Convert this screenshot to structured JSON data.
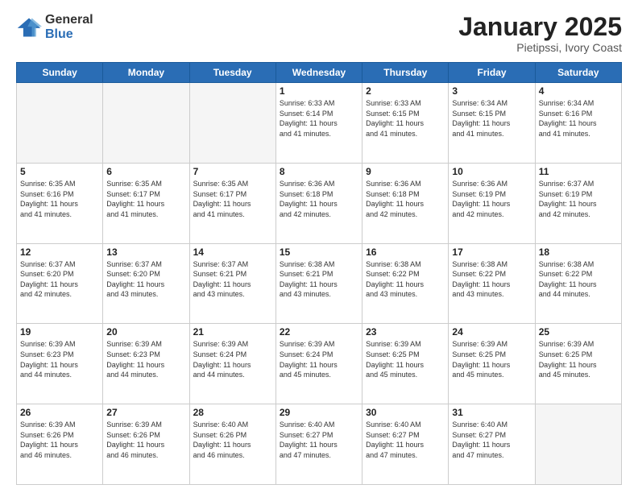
{
  "logo": {
    "general": "General",
    "blue": "Blue"
  },
  "header": {
    "month": "January 2025",
    "location": "Pietipssi, Ivory Coast"
  },
  "weekdays": [
    "Sunday",
    "Monday",
    "Tuesday",
    "Wednesday",
    "Thursday",
    "Friday",
    "Saturday"
  ],
  "weeks": [
    [
      {
        "day": "",
        "info": ""
      },
      {
        "day": "",
        "info": ""
      },
      {
        "day": "",
        "info": ""
      },
      {
        "day": "1",
        "info": "Sunrise: 6:33 AM\nSunset: 6:14 PM\nDaylight: 11 hours\nand 41 minutes."
      },
      {
        "day": "2",
        "info": "Sunrise: 6:33 AM\nSunset: 6:15 PM\nDaylight: 11 hours\nand 41 minutes."
      },
      {
        "day": "3",
        "info": "Sunrise: 6:34 AM\nSunset: 6:15 PM\nDaylight: 11 hours\nand 41 minutes."
      },
      {
        "day": "4",
        "info": "Sunrise: 6:34 AM\nSunset: 6:16 PM\nDaylight: 11 hours\nand 41 minutes."
      }
    ],
    [
      {
        "day": "5",
        "info": "Sunrise: 6:35 AM\nSunset: 6:16 PM\nDaylight: 11 hours\nand 41 minutes."
      },
      {
        "day": "6",
        "info": "Sunrise: 6:35 AM\nSunset: 6:17 PM\nDaylight: 11 hours\nand 41 minutes."
      },
      {
        "day": "7",
        "info": "Sunrise: 6:35 AM\nSunset: 6:17 PM\nDaylight: 11 hours\nand 41 minutes."
      },
      {
        "day": "8",
        "info": "Sunrise: 6:36 AM\nSunset: 6:18 PM\nDaylight: 11 hours\nand 42 minutes."
      },
      {
        "day": "9",
        "info": "Sunrise: 6:36 AM\nSunset: 6:18 PM\nDaylight: 11 hours\nand 42 minutes."
      },
      {
        "day": "10",
        "info": "Sunrise: 6:36 AM\nSunset: 6:19 PM\nDaylight: 11 hours\nand 42 minutes."
      },
      {
        "day": "11",
        "info": "Sunrise: 6:37 AM\nSunset: 6:19 PM\nDaylight: 11 hours\nand 42 minutes."
      }
    ],
    [
      {
        "day": "12",
        "info": "Sunrise: 6:37 AM\nSunset: 6:20 PM\nDaylight: 11 hours\nand 42 minutes."
      },
      {
        "day": "13",
        "info": "Sunrise: 6:37 AM\nSunset: 6:20 PM\nDaylight: 11 hours\nand 43 minutes."
      },
      {
        "day": "14",
        "info": "Sunrise: 6:37 AM\nSunset: 6:21 PM\nDaylight: 11 hours\nand 43 minutes."
      },
      {
        "day": "15",
        "info": "Sunrise: 6:38 AM\nSunset: 6:21 PM\nDaylight: 11 hours\nand 43 minutes."
      },
      {
        "day": "16",
        "info": "Sunrise: 6:38 AM\nSunset: 6:22 PM\nDaylight: 11 hours\nand 43 minutes."
      },
      {
        "day": "17",
        "info": "Sunrise: 6:38 AM\nSunset: 6:22 PM\nDaylight: 11 hours\nand 43 minutes."
      },
      {
        "day": "18",
        "info": "Sunrise: 6:38 AM\nSunset: 6:22 PM\nDaylight: 11 hours\nand 44 minutes."
      }
    ],
    [
      {
        "day": "19",
        "info": "Sunrise: 6:39 AM\nSunset: 6:23 PM\nDaylight: 11 hours\nand 44 minutes."
      },
      {
        "day": "20",
        "info": "Sunrise: 6:39 AM\nSunset: 6:23 PM\nDaylight: 11 hours\nand 44 minutes."
      },
      {
        "day": "21",
        "info": "Sunrise: 6:39 AM\nSunset: 6:24 PM\nDaylight: 11 hours\nand 44 minutes."
      },
      {
        "day": "22",
        "info": "Sunrise: 6:39 AM\nSunset: 6:24 PM\nDaylight: 11 hours\nand 45 minutes."
      },
      {
        "day": "23",
        "info": "Sunrise: 6:39 AM\nSunset: 6:25 PM\nDaylight: 11 hours\nand 45 minutes."
      },
      {
        "day": "24",
        "info": "Sunrise: 6:39 AM\nSunset: 6:25 PM\nDaylight: 11 hours\nand 45 minutes."
      },
      {
        "day": "25",
        "info": "Sunrise: 6:39 AM\nSunset: 6:25 PM\nDaylight: 11 hours\nand 45 minutes."
      }
    ],
    [
      {
        "day": "26",
        "info": "Sunrise: 6:39 AM\nSunset: 6:26 PM\nDaylight: 11 hours\nand 46 minutes."
      },
      {
        "day": "27",
        "info": "Sunrise: 6:39 AM\nSunset: 6:26 PM\nDaylight: 11 hours\nand 46 minutes."
      },
      {
        "day": "28",
        "info": "Sunrise: 6:40 AM\nSunset: 6:26 PM\nDaylight: 11 hours\nand 46 minutes."
      },
      {
        "day": "29",
        "info": "Sunrise: 6:40 AM\nSunset: 6:27 PM\nDaylight: 11 hours\nand 47 minutes."
      },
      {
        "day": "30",
        "info": "Sunrise: 6:40 AM\nSunset: 6:27 PM\nDaylight: 11 hours\nand 47 minutes."
      },
      {
        "day": "31",
        "info": "Sunrise: 6:40 AM\nSunset: 6:27 PM\nDaylight: 11 hours\nand 47 minutes."
      },
      {
        "day": "",
        "info": ""
      }
    ]
  ]
}
